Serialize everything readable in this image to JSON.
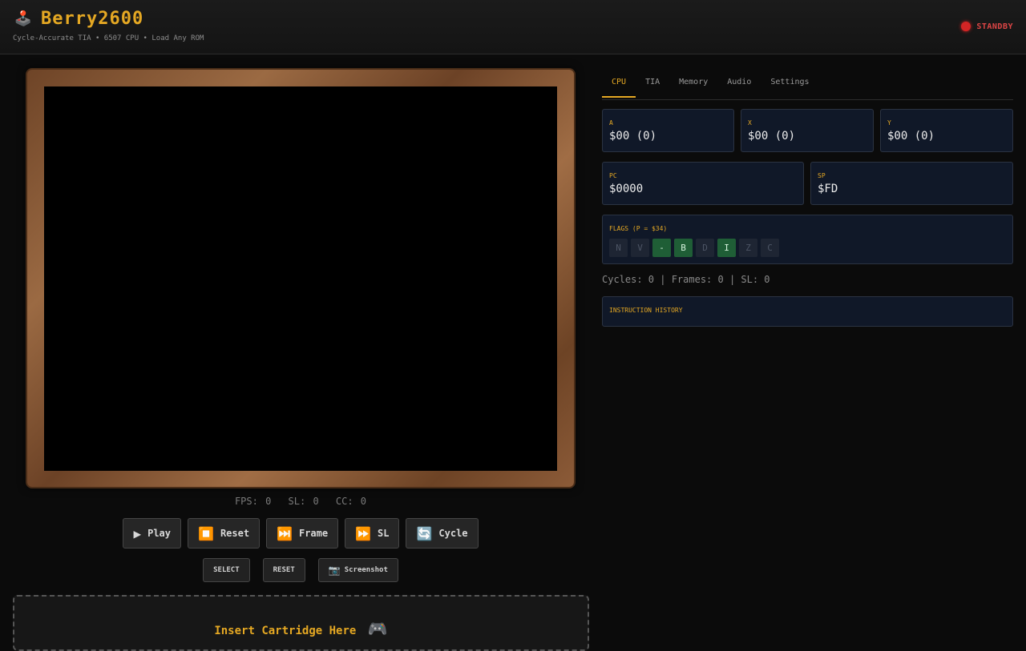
{
  "header": {
    "logo_icon": "joystick-icon",
    "logo_glyph": "🕹️",
    "title": "Berry2600",
    "subtitle": "Cycle-Accurate TIA • 6507 CPU • Load Any ROM",
    "status_text": "STANDBY",
    "status_color": "#d32525"
  },
  "stats": {
    "fps": "FPS: 0",
    "sl": "SL: 0",
    "cc": "CC: 0"
  },
  "controls": [
    {
      "icon": "play-icon",
      "glyph": "▶",
      "label": "Play"
    },
    {
      "icon": "stop-icon",
      "glyph": "⏹️",
      "label": "Reset"
    },
    {
      "icon": "next-track-icon",
      "glyph": "⏭️",
      "label": "Frame"
    },
    {
      "icon": "fast-forward-icon",
      "glyph": "⏩",
      "label": "SL"
    },
    {
      "icon": "cycle-arrows-icon",
      "glyph": "🔄",
      "label": "Cycle"
    }
  ],
  "sub_controls": {
    "select_label": "SELECT",
    "reset_label": "RESET",
    "screenshot_glyph": "📷",
    "screenshot_label": "Screenshot"
  },
  "cartridge": {
    "label": "Insert Cartridge Here",
    "glyph": "🎮"
  },
  "tabs": [
    "CPU",
    "TIA",
    "Memory",
    "Audio",
    "Settings"
  ],
  "active_tab": "CPU",
  "registers": {
    "a": {
      "label": "A",
      "value": "$00 (0)"
    },
    "x": {
      "label": "X",
      "value": "$00 (0)"
    },
    "y": {
      "label": "Y",
      "value": "$00 (0)"
    },
    "pc": {
      "label": "PC",
      "value": "$0000"
    },
    "sp": {
      "label": "SP",
      "value": "$FD"
    }
  },
  "flags": {
    "label": "FLAGS (P = $34)",
    "items": [
      {
        "name": "N",
        "on": false
      },
      {
        "name": "V",
        "on": false
      },
      {
        "name": "-",
        "on": true
      },
      {
        "name": "B",
        "on": true
      },
      {
        "name": "D",
        "on": false
      },
      {
        "name": "I",
        "on": true
      },
      {
        "name": "Z",
        "on": false
      },
      {
        "name": "C",
        "on": false
      }
    ]
  },
  "cycles_text": "Cycles: 0 | Frames: 0 | SL: 0",
  "history_label": "INSTRUCTION HISTORY",
  "colors": {
    "accent": "#e5a823",
    "flag_on": "#1f5e36",
    "panel_bg": "#101828"
  }
}
